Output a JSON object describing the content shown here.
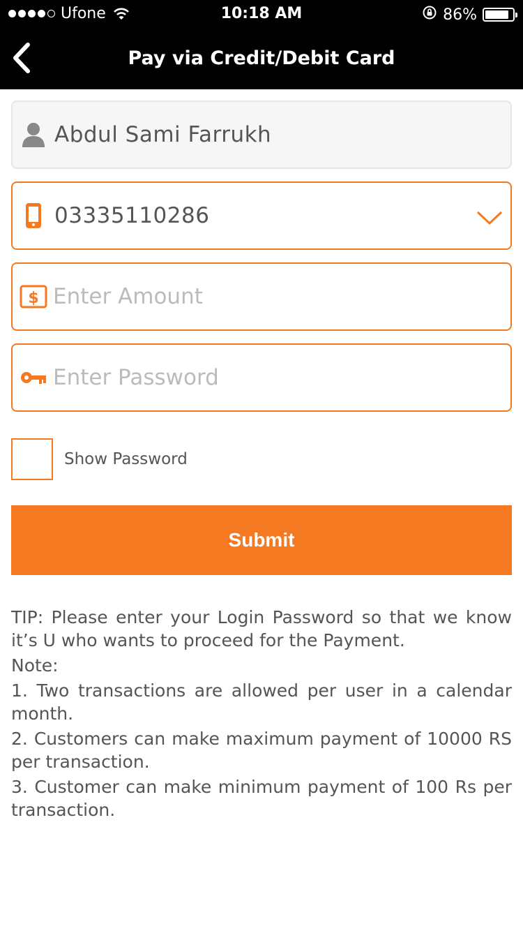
{
  "status_bar": {
    "carrier": "Ufone",
    "time": "10:18 AM",
    "battery": "86%",
    "battery_level": 0.86,
    "icons": [
      "signal-dots",
      "wifi-icon",
      "orientation-lock-icon",
      "battery-icon"
    ]
  },
  "nav": {
    "title": "Pay via Credit/Debit Card",
    "back_icon": "chevron-left-icon"
  },
  "form": {
    "name": {
      "value": "Abdul Sami Farrukh",
      "icon": "person-icon"
    },
    "phone": {
      "value": "03335110286",
      "icon": "mobile-phone-icon",
      "dropdown_icon": "chevron-down-icon"
    },
    "amount": {
      "placeholder": "Enter Amount",
      "icon": "dollar-icon"
    },
    "password": {
      "placeholder": "Enter Password",
      "icon": "key-icon"
    },
    "show_password_label": "Show Password",
    "submit_label": "Submit"
  },
  "notes": {
    "tip": "TIP: Please enter your Login Password so that we know it’s U who wants to proceed for the Payment.",
    "heading": "Note:",
    "items": [
      "1. Two transactions are allowed per user in a calendar month.",
      "2. Customers can make maximum payment of 10000 RS per transaction.",
      "3. Customer can make minimum payment of 100 Rs per transaction."
    ]
  },
  "colors": {
    "accent": "#f47920",
    "nav_bg": "#000000",
    "text": "#555555"
  }
}
